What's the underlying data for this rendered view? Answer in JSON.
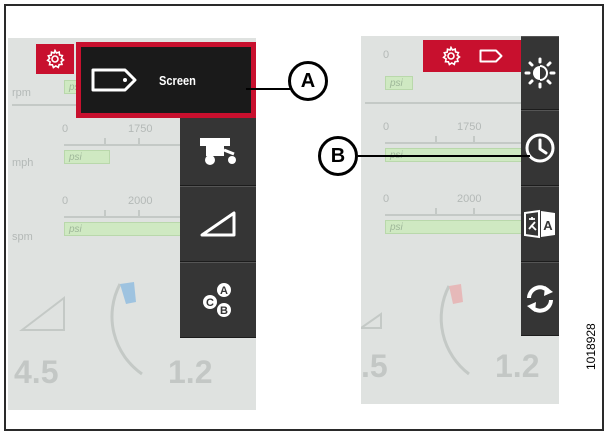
{
  "panel_a": {
    "gauges": {
      "row1": {
        "unit": "rpm",
        "bar_label": "psi"
      },
      "row2": {
        "unit": "mph",
        "scale_min": "0",
        "scale_max": "1750",
        "bar_label": "psi"
      },
      "row3": {
        "unit": "spm",
        "scale_min": "0",
        "scale_max": "2000",
        "bar_label": "psi"
      }
    },
    "big_value_left": "4.5",
    "big_value_right": "1.2",
    "menu": {
      "screen_label": "Screen",
      "items": [
        "screen-icon",
        "windrower-icon",
        "header-angle-icon",
        "abc-settings-icon"
      ]
    }
  },
  "panel_b": {
    "gauges": {
      "row1": {
        "scale_min": "0",
        "bar_label": "psi"
      },
      "row2": {
        "scale_min": "0",
        "scale_max": "1750",
        "bar_label": "psi"
      },
      "row3": {
        "scale_min": "0",
        "scale_max": "2000",
        "bar_label": "psi"
      }
    },
    "big_value_left": ".5",
    "big_value_right": "1.2",
    "menu": {
      "items": [
        "brightness-icon",
        "clock-icon",
        "language-icon",
        "refresh-icon"
      ]
    }
  },
  "callouts": {
    "a": "A",
    "b": "B"
  },
  "figure_number": "1018928",
  "colors": {
    "accent_red": "#c8102e",
    "menu_dark": "#353535",
    "bar_green": "#cfe9c2"
  }
}
